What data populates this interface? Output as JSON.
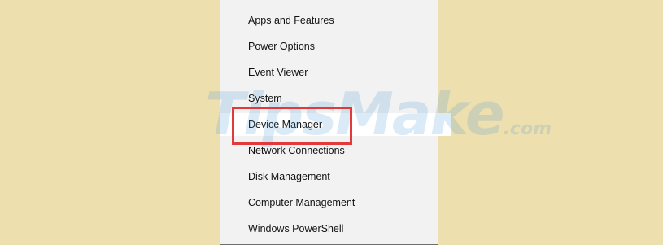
{
  "background_color": "#eedfae",
  "menu": {
    "items": [
      {
        "label": "Apps and Features",
        "name": "menu-item-apps-and-features"
      },
      {
        "label": "Power Options",
        "name": "menu-item-power-options"
      },
      {
        "label": "Event Viewer",
        "name": "menu-item-event-viewer"
      },
      {
        "label": "System",
        "name": "menu-item-system"
      },
      {
        "label": "Device Manager",
        "name": "menu-item-device-manager",
        "hovered": true
      },
      {
        "label": "Network Connections",
        "name": "menu-item-network-connections"
      },
      {
        "label": "Disk Management",
        "name": "menu-item-disk-management"
      },
      {
        "label": "Computer Management",
        "name": "menu-item-computer-management"
      },
      {
        "label": "Windows PowerShell",
        "name": "menu-item-windows-powershell"
      }
    ]
  },
  "highlight": {
    "target": "Device Manager",
    "color": "#e03a3a"
  },
  "watermark": {
    "brand": "TipsMake",
    "suffix": ".com"
  }
}
